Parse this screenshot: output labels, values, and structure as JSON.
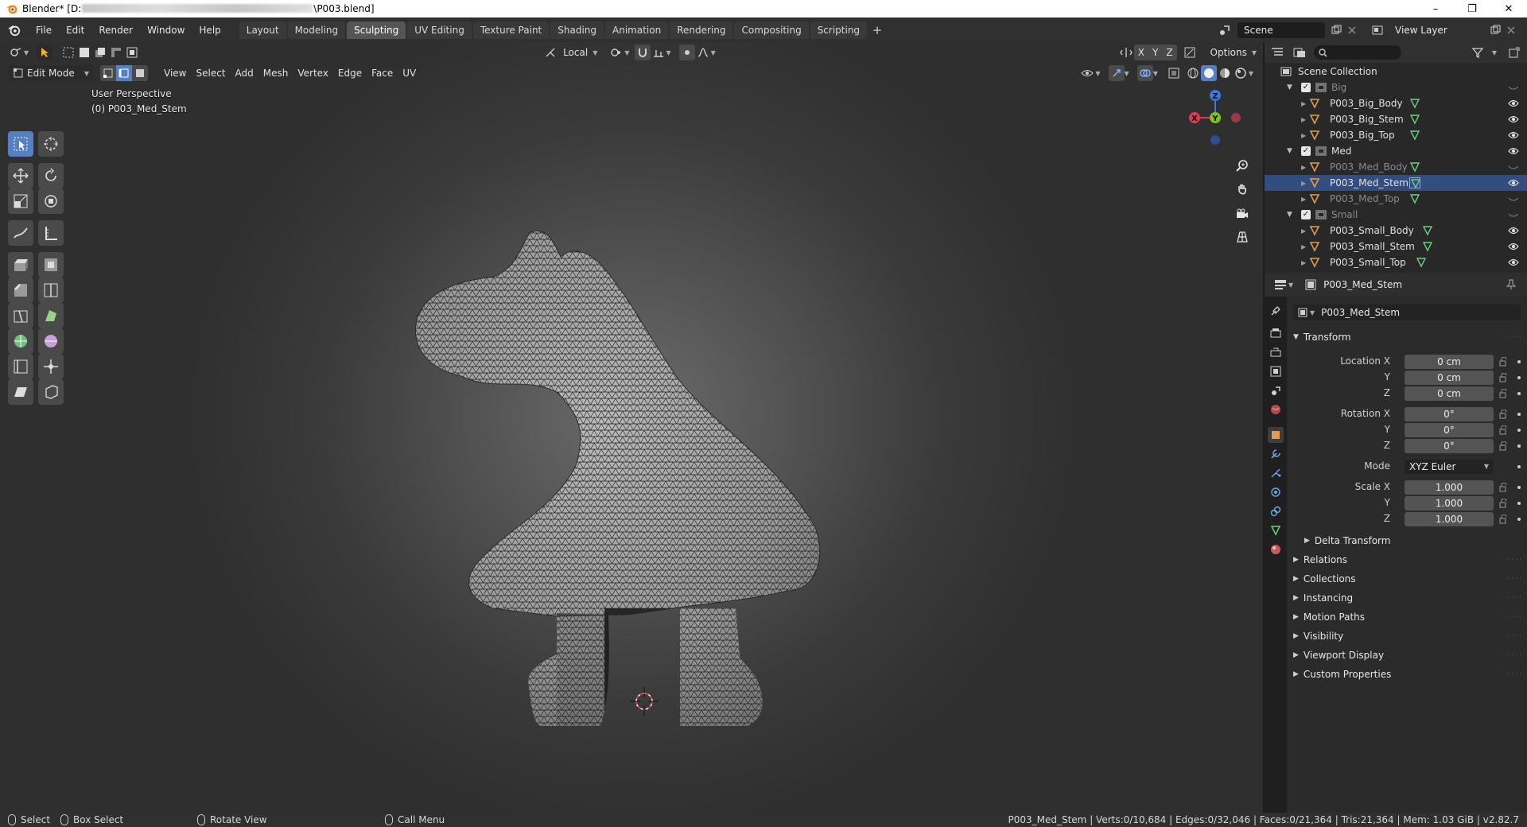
{
  "titlebar": {
    "title_prefix": "Blender* [D:",
    "title_suffix": "\\P003.blend]",
    "minimize": "–",
    "maximize": "❐",
    "close": "✕"
  },
  "menubar": {
    "menus": [
      "File",
      "Edit",
      "Render",
      "Window",
      "Help"
    ],
    "workspaces": [
      "Layout",
      "Modeling",
      "Sculpting",
      "UV Editing",
      "Texture Paint",
      "Shading",
      "Animation",
      "Rendering",
      "Compositing",
      "Scripting"
    ],
    "active_workspace": "Sculpting",
    "add_tab": "+",
    "scene": "Scene",
    "view_layer": "View Layer"
  },
  "viewport": {
    "header": {
      "transform_orientation": "Local",
      "axes": [
        "X",
        "Y",
        "Z"
      ],
      "options": "Options"
    },
    "header2": {
      "mode": "Edit Mode",
      "menus": [
        "View",
        "Select",
        "Add",
        "Mesh",
        "Vertex",
        "Edge",
        "Face",
        "UV"
      ]
    },
    "overlay": {
      "perspective": "User Perspective",
      "object": "(0) P003_Med_Stem"
    },
    "gizmo": {
      "x": "X",
      "y": "Y",
      "z": "Z"
    }
  },
  "outliner": {
    "root": "Scene Collection",
    "rows": [
      {
        "name": "Big",
        "type": "collection",
        "dim": true
      },
      {
        "name": "P003_Big_Body",
        "type": "object"
      },
      {
        "name": "P003_Big_Stem",
        "type": "object"
      },
      {
        "name": "P003_Big_Top",
        "type": "object"
      },
      {
        "name": "Med",
        "type": "collection"
      },
      {
        "name": "P003_Med_Body",
        "type": "object",
        "dim": true
      },
      {
        "name": "P003_Med_Stem",
        "type": "object",
        "selected": true
      },
      {
        "name": "P003_Med_Top",
        "type": "object",
        "dim": true
      },
      {
        "name": "Small",
        "type": "collection",
        "dim": true
      },
      {
        "name": "P003_Small_Body",
        "type": "object"
      },
      {
        "name": "P003_Small_Stem",
        "type": "object"
      },
      {
        "name": "P003_Small_Top",
        "type": "object"
      }
    ]
  },
  "properties": {
    "header_object": "P003_Med_Stem",
    "object_name": "P003_Med_Stem",
    "transform_title": "Transform",
    "location": {
      "label_x": "Location X",
      "label_y": "Y",
      "label_z": "Z",
      "x": "0 cm",
      "y": "0 cm",
      "z": "0 cm"
    },
    "rotation": {
      "label_x": "Rotation X",
      "label_y": "Y",
      "label_z": "Z",
      "x": "0°",
      "y": "0°",
      "z": "0°"
    },
    "mode_label": "Mode",
    "mode_value": "XYZ Euler",
    "scale": {
      "label_x": "Scale X",
      "label_y": "Y",
      "label_z": "Z",
      "x": "1.000",
      "y": "1.000",
      "z": "1.000"
    },
    "delta": "Delta Transform",
    "panels": [
      "Relations",
      "Collections",
      "Instancing",
      "Motion Paths",
      "Visibility",
      "Viewport Display",
      "Custom Properties"
    ]
  },
  "statusbar": {
    "select": "Select",
    "box_select": "Box Select",
    "rotate_view": "Rotate View",
    "call_menu": "Call Menu",
    "stats": "P003_Med_Stem | Verts:0/10,684 | Edges:0/32,046 | Faces:0/21,364 | Tris:21,364 | Mem: 1.03 GiB | v2.82.7"
  },
  "colors": {
    "accent": "#5680c2",
    "selection": "#334d80",
    "axis_x": "#e03a4e",
    "axis_y": "#7ec321",
    "axis_z": "#3d78e0",
    "object_orange": "#e29b51",
    "mesh_green": "#6ccf7d"
  }
}
